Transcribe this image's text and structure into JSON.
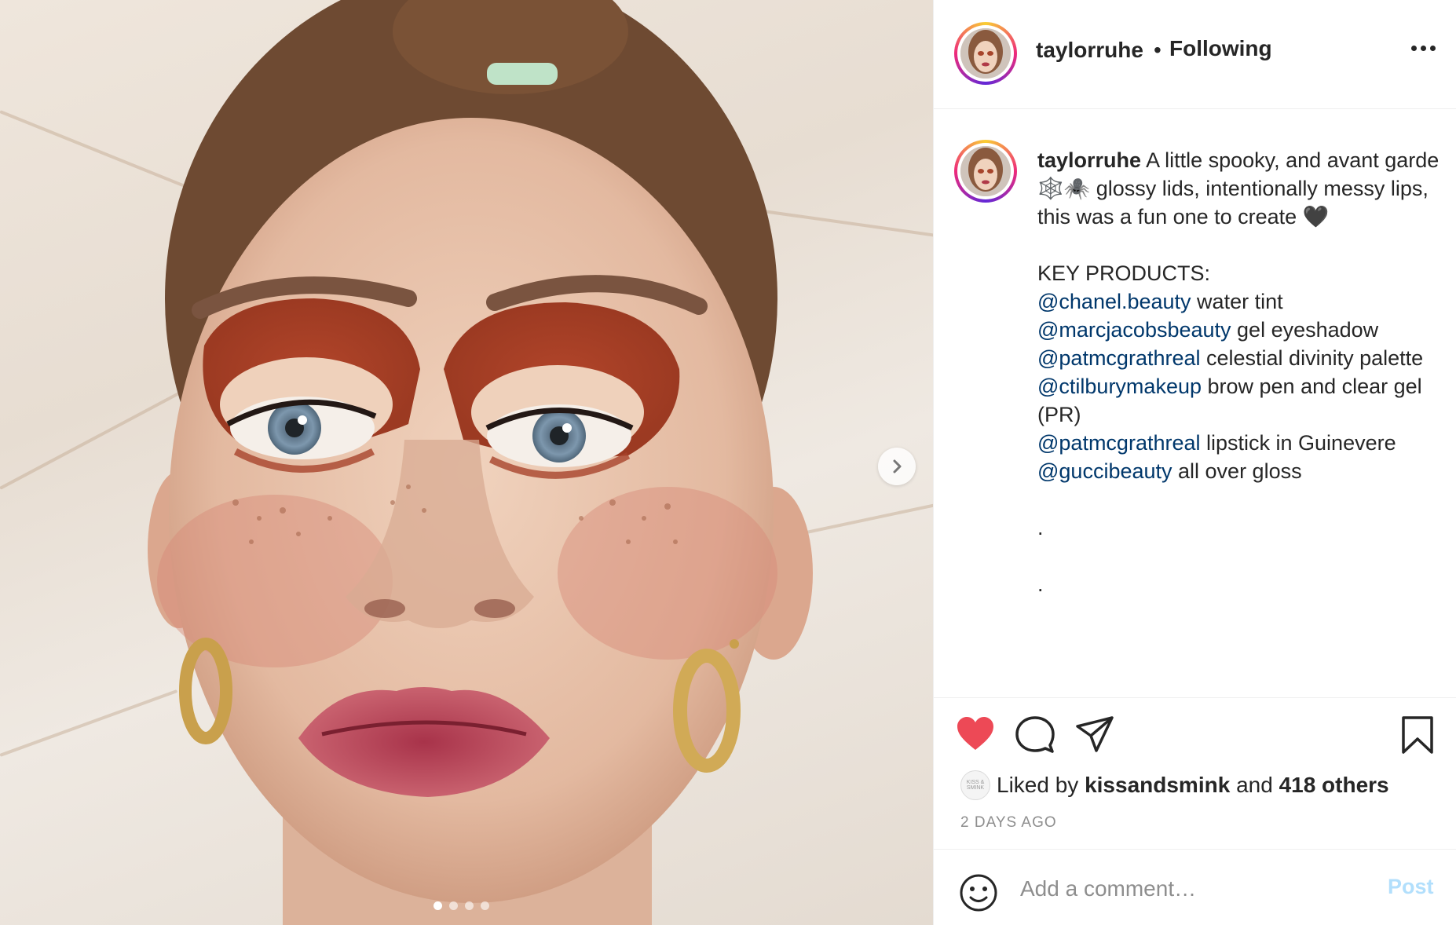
{
  "post": {
    "username": "taylorruhe",
    "separator": "•",
    "follow_status": "Following",
    "more_icon": "more-horizontal-icon"
  },
  "caption": {
    "username": "taylorruhe",
    "intro": "A little spooky, and avant garde 🕸️🕷️ glossy lids, intentionally messy lips, this was a fun one to create 🖤",
    "key_heading": "KEY PRODUCTS:",
    "products": [
      {
        "mention": "@chanel.beauty",
        "text": " water tint"
      },
      {
        "mention": "@marcjacobsbeauty",
        "text": " gel eyeshadow"
      },
      {
        "mention": "@patmcgrathreal",
        "text": " celestial divinity palette"
      },
      {
        "mention": "@ctilburymakeup",
        "text": " brow pen and clear gel (PR)"
      },
      {
        "mention": "@patmcgrathreal",
        "text": " lipstick in Guinevere"
      },
      {
        "mention": "@guccibeauty",
        "text": " all over gloss"
      }
    ],
    "trailing_dots": [
      ".",
      "."
    ]
  },
  "actions": {
    "like_icon": "heart-filled-icon",
    "comment_icon": "comment-icon",
    "share_icon": "share-icon",
    "save_icon": "bookmark-icon",
    "liked": true,
    "like_color": "#ed4956"
  },
  "likes": {
    "avatar_text": "KISS & SMINK",
    "prefix": "Liked by",
    "liker": "kissandsmink",
    "connector": "and",
    "others": "418 others"
  },
  "timestamp": "2 DAYS AGO",
  "comment": {
    "placeholder": "Add a comment…",
    "post_label": "Post",
    "emoji_icon": "smiley-icon"
  },
  "media": {
    "carousel_count": 4,
    "active_index": 0,
    "next_icon": "chevron-right-icon"
  },
  "colors": {
    "mention": "#00376b",
    "post_disabled": "#b2dffc",
    "secondary_text": "#8e8e8e"
  }
}
